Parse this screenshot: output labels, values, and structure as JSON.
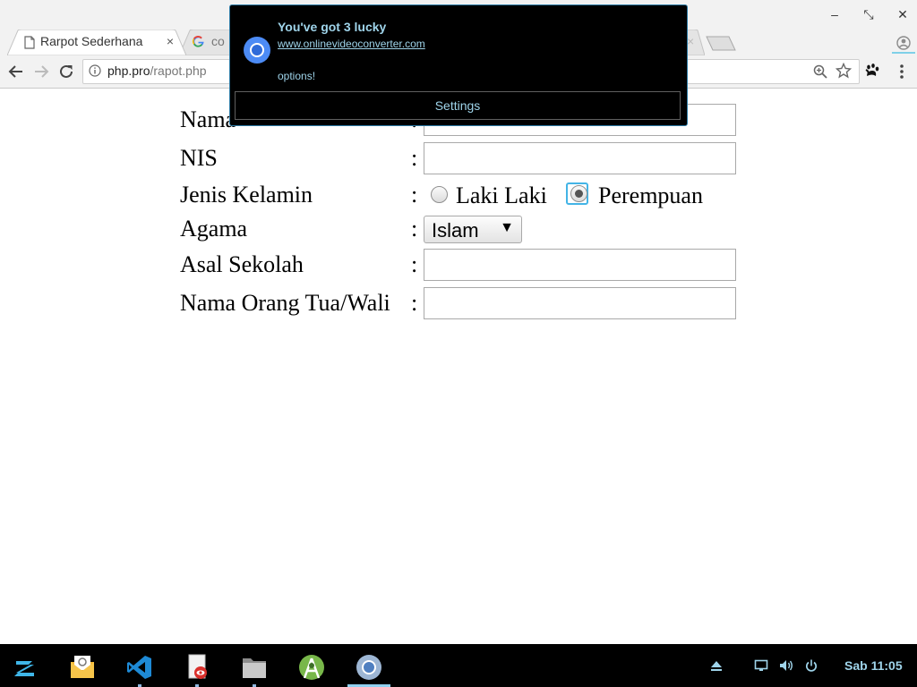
{
  "browser": {
    "tabs": [
      {
        "title": "Rarpot Sederhana",
        "close": "×",
        "active": true
      },
      {
        "title": "co",
        "active": false
      }
    ],
    "ghost_tab_close": "×",
    "window_controls": {
      "minimize": "–",
      "restore": "⤡",
      "close": "✕"
    },
    "url_host": "php.pro",
    "url_path": "/rapot.php"
  },
  "notification": {
    "title": "You've got 3 lucky",
    "url": "www.onlinevideoconverter.com",
    "message": "options!",
    "settings_label": "Settings"
  },
  "form": {
    "labels": {
      "nama": "Nama",
      "nis": "NIS",
      "jenis_kelamin": "Jenis Kelamin",
      "agama": "Agama",
      "asal_sekolah": "Asal Sekolah",
      "orang_tua": "Nama Orang Tua/Wali"
    },
    "colon": ":",
    "gender_options": [
      "Laki Laki",
      "Perempuan"
    ],
    "gender_selected": "Perempuan",
    "agama_value": "Islam",
    "select_arrow": "▼"
  },
  "taskbar": {
    "apps": [
      "zorin-menu",
      "mail",
      "vscode",
      "document-viewer",
      "files",
      "android-studio",
      "chrome"
    ],
    "clock": "Sab 11:05"
  },
  "colors": {
    "notification_text": "#9fd4ea",
    "chrome_blue": "#4c8bf5",
    "focus_ring": "#43b4e6"
  }
}
